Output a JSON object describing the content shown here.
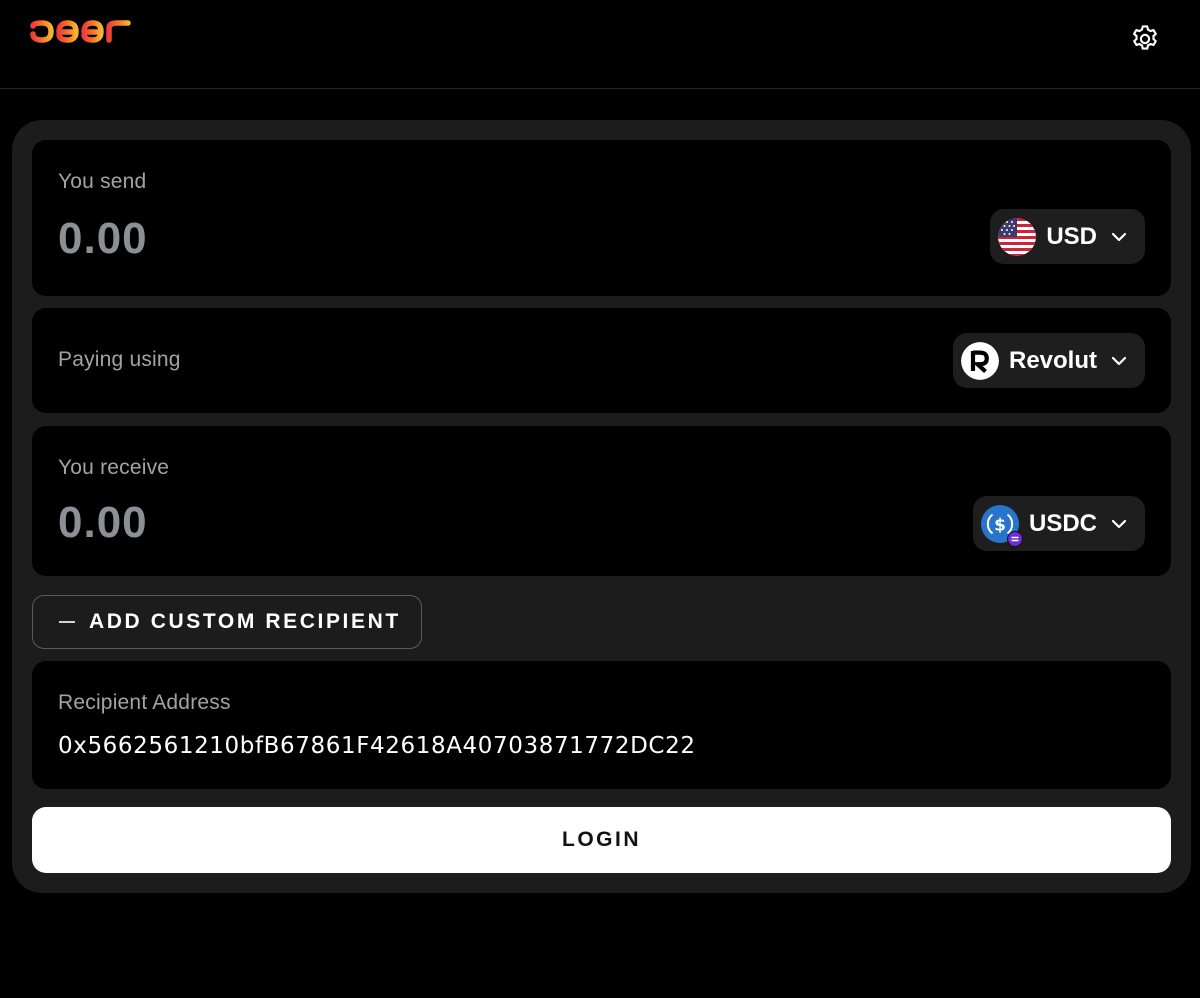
{
  "header": {
    "logo_text": "peer",
    "settings_icon": "gear-icon"
  },
  "send": {
    "label": "You send",
    "amount": "0.00",
    "currency": "USD",
    "currency_icon": "us-flag-icon"
  },
  "payment": {
    "label": "Paying using",
    "method": "Revolut",
    "method_icon": "revolut-icon"
  },
  "receive": {
    "label": "You receive",
    "amount": "0.00",
    "token": "USDC",
    "token_icon": "usdc-icon"
  },
  "recipient": {
    "toggle_label": "ADD CUSTOM RECIPIENT",
    "toggle_icon": "minus-icon",
    "address_label": "Recipient Address",
    "address_value": "0x5662561210bfB67861F42618A40703871772DC22"
  },
  "actions": {
    "login_label": "LOGIN"
  },
  "colors": {
    "background": "#000000",
    "panel": "#1c1c1c",
    "card": "#000000",
    "muted_text": "#a3a3a3",
    "amount_text": "#8b8f96",
    "logo_gradient": [
      "#f0622f",
      "#f5a623"
    ]
  }
}
